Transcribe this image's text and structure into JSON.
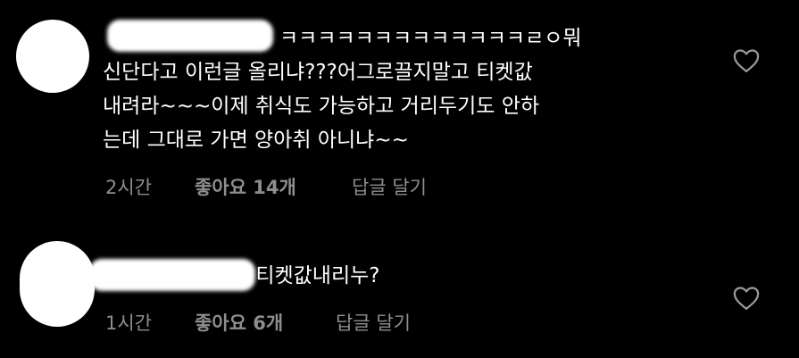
{
  "comments": [
    {
      "text": "ㅋㅋㅋㅋㅋㅋㅋㅋㅋㅋㅋㅋㅋㄹㅇ뭐\n신단다고 이런글 올리냐???어그로끌지말고 티켓값\n내려라~~~이제 취식도 가능하고 거리두기도 안하\n는데 그대로 가면 양아취 아니냐~~",
      "time": "2시간",
      "likes_label": "좋아요 14개",
      "reply_label": "답글 달기",
      "like_icon": "heart-icon"
    },
    {
      "text": "t 티켓값내리누?",
      "time": "1시간",
      "likes_label": "좋아요 6개",
      "reply_label": "답글 달기",
      "like_icon": "heart-icon"
    }
  ],
  "colors": {
    "background": "#000000",
    "text": "#ffffff",
    "meta": "#8e8e8e"
  }
}
